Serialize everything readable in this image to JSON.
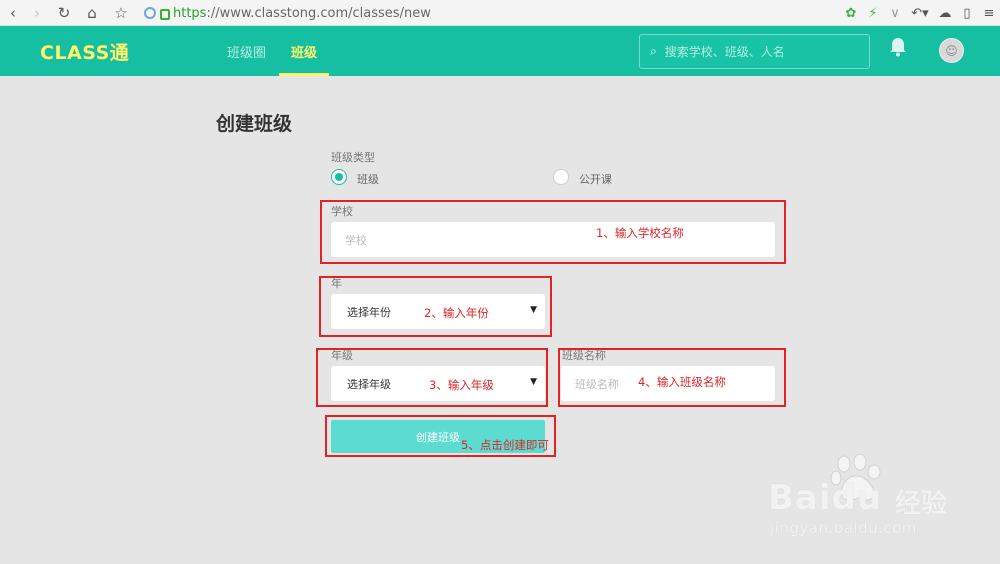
{
  "browser": {
    "url_https": "https",
    "url_rest": "://www.classtong.com/classes/new",
    "icons": [
      "back-icon",
      "forward-icon",
      "reload-icon",
      "home-icon",
      "bookmark-star-icon",
      "shield-icon",
      "lock-icon",
      "extension-icon",
      "lightning-icon",
      "dropdown-icon",
      "undo-icon",
      "cloud-icon",
      "tablet-icon",
      "menu-icon"
    ]
  },
  "header": {
    "logo": "CLASS通",
    "tabs": [
      {
        "label": "班级圈",
        "active": false
      },
      {
        "label": "班级",
        "active": true
      }
    ],
    "search_placeholder": "搜索学校、班级、人名",
    "colors": {
      "bar": "#17bfa2",
      "accent": "#fff36b"
    }
  },
  "form": {
    "title": "创建班级",
    "class_type_label": "班级类型",
    "radio_options": [
      {
        "label": "班级",
        "selected": true
      },
      {
        "label": "公开课",
        "selected": false
      }
    ],
    "school_label": "学校",
    "school_placeholder": "学校",
    "year_label": "年",
    "year_select": "选择年份",
    "grade_label": "年级",
    "grade_select": "选择年级",
    "class_name_label": "班级名称",
    "class_name_placeholder": "班级名称",
    "submit_label": "创建班级"
  },
  "annotations": [
    "1、输入学校名称",
    "2、输入年份",
    "3、输入年级",
    "4、输入班级名称",
    "5、点击创建即可"
  ],
  "watermark": {
    "brand": "Baidu",
    "jingyan": "经验",
    "url": "jingyan.baidu.com"
  }
}
